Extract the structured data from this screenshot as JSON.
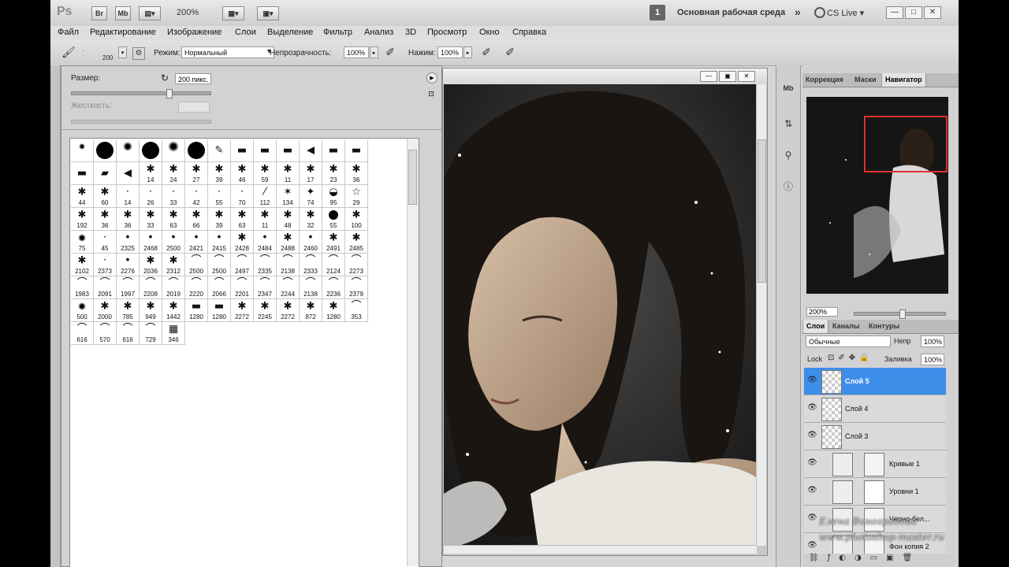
{
  "app": {
    "logo": "Ps",
    "bridge_btn": "Br",
    "minibridge_btn": "Mb",
    "zoom": "200%",
    "workspace_number": "1",
    "workspace_name": "Основная рабочая среда",
    "cs_live": "CS Live"
  },
  "menu": [
    "Файл",
    "Редактирование",
    "Изображение",
    "Слои",
    "Выделение",
    "Фильтр",
    "Анализ",
    "3D",
    "Просмотр",
    "Окно",
    "Справка"
  ],
  "options": {
    "brush_size": "200",
    "mode_label": "Режим:",
    "mode_value": "Нормальный",
    "opacity_label": "Непрозрачность:",
    "opacity_value": "100%",
    "flow_label": "Нажим:",
    "flow_value": "100%"
  },
  "brush_panel": {
    "size_label": "Размер:",
    "size_value": "200 пикс.",
    "size_fraction": 0.7,
    "hardness_label": "Жесткость:",
    "hardness_value": ""
  },
  "brush_presets": [
    {
      "k": "soft",
      "s": 8,
      "n": ""
    },
    {
      "k": "hard",
      "s": 22,
      "n": ""
    },
    {
      "k": "soft",
      "s": 12,
      "n": ""
    },
    {
      "k": "hard",
      "s": 22,
      "n": ""
    },
    {
      "k": "soft",
      "s": 14,
      "n": ""
    },
    {
      "k": "hard",
      "s": 22,
      "n": ""
    },
    {
      "k": "glyph",
      "g": "✎",
      "n": ""
    },
    {
      "k": "glyph",
      "g": "▬",
      "n": ""
    },
    {
      "k": "glyph",
      "g": "▬",
      "n": ""
    },
    {
      "k": "glyph",
      "g": "▬",
      "n": ""
    },
    {
      "k": "glyph",
      "g": "◀",
      "n": ""
    },
    {
      "k": "glyph",
      "g": "▬",
      "n": ""
    },
    {
      "k": "glyph",
      "g": "▬",
      "n": ""
    },
    {
      "k": "glyph",
      "g": "▬",
      "n": ""
    },
    {
      "k": "glyph",
      "g": "▰",
      "n": ""
    },
    {
      "k": "glyph",
      "g": "◀",
      "n": ""
    },
    {
      "k": "glyph",
      "g": "✱",
      "n": "14"
    },
    {
      "k": "glyph",
      "g": "✱",
      "n": "24"
    },
    {
      "k": "glyph",
      "g": "✱",
      "n": "27"
    },
    {
      "k": "glyph",
      "g": "✱",
      "n": "39"
    },
    {
      "k": "glyph",
      "g": "✱",
      "n": "46"
    },
    {
      "k": "glyph",
      "g": "✱",
      "n": "59"
    },
    {
      "k": "glyph",
      "g": "✱",
      "n": "11"
    },
    {
      "k": "glyph",
      "g": "✱",
      "n": "17"
    },
    {
      "k": "glyph",
      "g": "✱",
      "n": "23"
    },
    {
      "k": "glyph",
      "g": "✱",
      "n": "36"
    },
    {
      "k": "glyph",
      "g": "✱",
      "n": "44"
    },
    {
      "k": "glyph",
      "g": "✱",
      "n": "60"
    },
    {
      "k": "glyph",
      "g": "·",
      "n": "14"
    },
    {
      "k": "glyph",
      "g": "·",
      "n": "26"
    },
    {
      "k": "glyph",
      "g": "·",
      "n": "33"
    },
    {
      "k": "glyph",
      "g": "·",
      "n": "42"
    },
    {
      "k": "glyph",
      "g": "·",
      "n": "55"
    },
    {
      "k": "glyph",
      "g": "·",
      "n": "70"
    },
    {
      "k": "glyph",
      "g": "⁄",
      "n": "112"
    },
    {
      "k": "glyph",
      "g": "✶",
      "n": "134"
    },
    {
      "k": "glyph",
      "g": "✦",
      "n": "74"
    },
    {
      "k": "glyph",
      "g": "◒",
      "n": "95"
    },
    {
      "k": "glyph",
      "g": "☆",
      "n": "29"
    },
    {
      "k": "glyph",
      "g": "✱",
      "n": "192"
    },
    {
      "k": "glyph",
      "g": "✱",
      "n": "36"
    },
    {
      "k": "glyph",
      "g": "✱",
      "n": "36"
    },
    {
      "k": "glyph",
      "g": "✱",
      "n": "33"
    },
    {
      "k": "glyph",
      "g": "✱",
      "n": "63"
    },
    {
      "k": "glyph",
      "g": "✱",
      "n": "66"
    },
    {
      "k": "glyph",
      "g": "✱",
      "n": "39"
    },
    {
      "k": "glyph",
      "g": "✱",
      "n": "63"
    },
    {
      "k": "glyph",
      "g": "✱",
      "n": "11"
    },
    {
      "k": "glyph",
      "g": "✱",
      "n": "48"
    },
    {
      "k": "glyph",
      "g": "✱",
      "n": "32"
    },
    {
      "k": "hard",
      "s": 12,
      "n": "55"
    },
    {
      "k": "glyph",
      "g": "✱",
      "n": "100"
    },
    {
      "k": "soft",
      "s": 10,
      "n": "75"
    },
    {
      "k": "glyph",
      "g": "·",
      "n": "45"
    },
    {
      "k": "glyph",
      "g": "•",
      "n": "2325"
    },
    {
      "k": "glyph",
      "g": "•",
      "n": "2468"
    },
    {
      "k": "glyph",
      "g": "•",
      "n": "2500"
    },
    {
      "k": "glyph",
      "g": "•",
      "n": "2421"
    },
    {
      "k": "glyph",
      "g": "•",
      "n": "2415"
    },
    {
      "k": "glyph",
      "g": "✱",
      "n": "2428"
    },
    {
      "k": "glyph",
      "g": "•",
      "n": "2484"
    },
    {
      "k": "glyph",
      "g": "✱",
      "n": "2488"
    },
    {
      "k": "glyph",
      "g": "•",
      "n": "2460"
    },
    {
      "k": "glyph",
      "g": "✱",
      "n": "2491"
    },
    {
      "k": "glyph",
      "g": "✱",
      "n": "2485"
    },
    {
      "k": "glyph",
      "g": "✱",
      "n": "2102"
    },
    {
      "k": "glyph",
      "g": "·",
      "n": "2373"
    },
    {
      "k": "glyph",
      "g": "•",
      "n": "2276"
    },
    {
      "k": "glyph",
      "g": "✱",
      "n": "2036"
    },
    {
      "k": "glyph",
      "g": "✱",
      "n": "2312"
    },
    {
      "k": "glyph",
      "g": "⌒",
      "n": "2500"
    },
    {
      "k": "glyph",
      "g": "⌒",
      "n": "2500"
    },
    {
      "k": "glyph",
      "g": "⌒",
      "n": "2497"
    },
    {
      "k": "glyph",
      "g": "⌒",
      "n": "2335"
    },
    {
      "k": "glyph",
      "g": "⌒",
      "n": "2138"
    },
    {
      "k": "glyph",
      "g": "⌒",
      "n": "2333"
    },
    {
      "k": "glyph",
      "g": "⌒",
      "n": "2124"
    },
    {
      "k": "glyph",
      "g": "⌒",
      "n": "2273"
    },
    {
      "k": "glyph",
      "g": "⌒",
      "n": "1983"
    },
    {
      "k": "glyph",
      "g": "⌒",
      "n": "2091"
    },
    {
      "k": "glyph",
      "g": "⌒",
      "n": "1997"
    },
    {
      "k": "glyph",
      "g": "⌒",
      "n": "2208"
    },
    {
      "k": "glyph",
      "g": "⌒",
      "n": "2019"
    },
    {
      "k": "glyph",
      "g": "⌒",
      "n": "2220"
    },
    {
      "k": "glyph",
      "g": "⌒",
      "n": "2066"
    },
    {
      "k": "glyph",
      "g": "⌒",
      "n": "2201"
    },
    {
      "k": "glyph",
      "g": "⌒",
      "n": "2347"
    },
    {
      "k": "glyph",
      "g": "⌒",
      "n": "2244"
    },
    {
      "k": "glyph",
      "g": "⌒",
      "n": "2138"
    },
    {
      "k": "glyph",
      "g": "⌒",
      "n": "2236"
    },
    {
      "k": "glyph",
      "g": "⌒",
      "n": "2379"
    },
    {
      "k": "soft",
      "s": 10,
      "n": "500"
    },
    {
      "k": "glyph",
      "g": "✱",
      "n": "2000"
    },
    {
      "k": "glyph",
      "g": "✱",
      "n": "785"
    },
    {
      "k": "glyph",
      "g": "✱",
      "n": "949"
    },
    {
      "k": "glyph",
      "g": "✱",
      "n": "1442"
    },
    {
      "k": "glyph",
      "g": "▬",
      "n": "1280"
    },
    {
      "k": "glyph",
      "g": "▬",
      "n": "1280"
    },
    {
      "k": "glyph",
      "g": "✱",
      "n": "2272"
    },
    {
      "k": "glyph",
      "g": "✱",
      "n": "2245"
    },
    {
      "k": "glyph",
      "g": "✱",
      "n": "2272"
    },
    {
      "k": "glyph",
      "g": "✱",
      "n": "872"
    },
    {
      "k": "glyph",
      "g": "✱",
      "n": "1280"
    },
    {
      "k": "glyph",
      "g": "⌒",
      "n": "353"
    },
    {
      "k": "glyph",
      "g": "⌒",
      "n": "616"
    },
    {
      "k": "glyph",
      "g": "⌒",
      "n": "570"
    },
    {
      "k": "glyph",
      "g": "⌒",
      "n": "616"
    },
    {
      "k": "glyph",
      "g": "⌒",
      "n": "729"
    },
    {
      "k": "glyph",
      "g": "▦",
      "n": "346"
    }
  ],
  "right_panel": {
    "tabs": [
      "Коррекция",
      "Маски",
      "Навигатор"
    ],
    "nav_zoom": "200%",
    "layer_tabs": [
      "Слои",
      "Каналы",
      "Контуры"
    ],
    "blend_mode": "Обычные",
    "opacity_label": "Непр",
    "opacity_value": "100%",
    "lock_label": "Lock",
    "fill_label": "Заливка",
    "fill_value": "100%",
    "layers": [
      {
        "name": "Слой 5",
        "selected": true
      },
      {
        "name": "Слой 4",
        "selected": false
      },
      {
        "name": "Слой 3",
        "selected": false
      },
      {
        "name": "Кривые 1",
        "selected": false
      },
      {
        "name": "Уровни 1",
        "selected": false
      },
      {
        "name": "Черно-бел...",
        "selected": false
      },
      {
        "name": "Фон копия 2",
        "selected": false
      }
    ]
  },
  "watermark": {
    "line1": "Елена Виноградова",
    "line2": "www.photoshop-master.ru"
  },
  "colors": {
    "selected_layer": "#3d8ee9",
    "nav_rect": "#e03030"
  }
}
